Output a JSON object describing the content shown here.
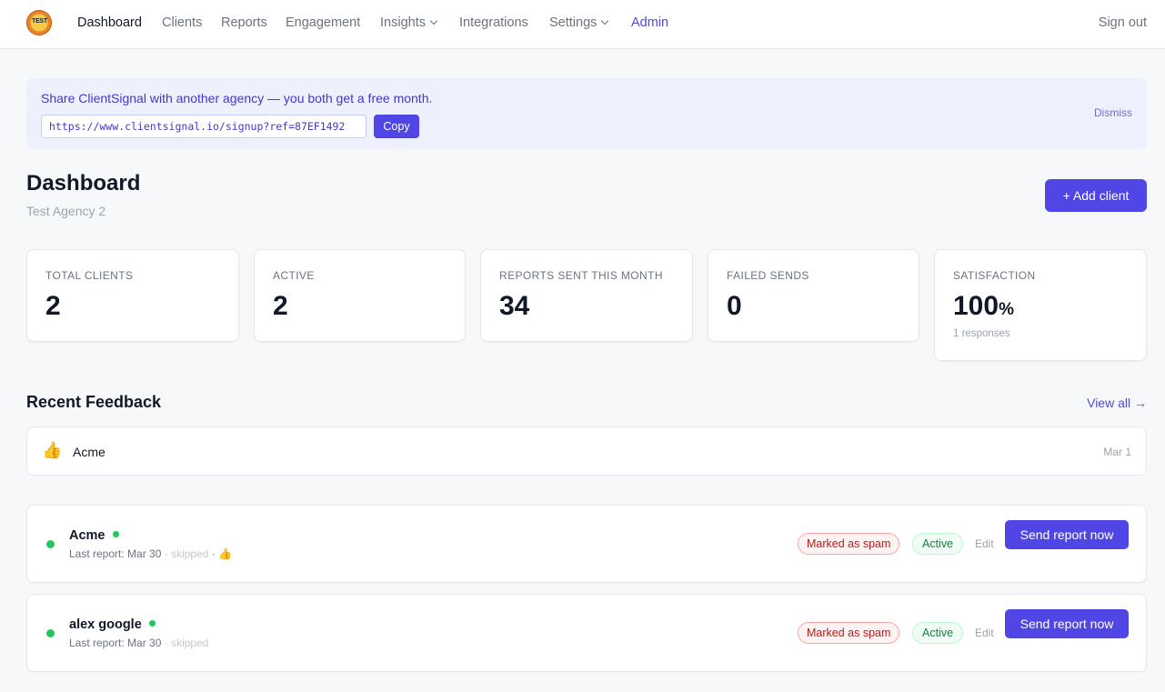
{
  "nav": {
    "logo_text": "TEST",
    "items": [
      "Dashboard",
      "Clients",
      "Reports",
      "Engagement",
      "Insights",
      "Integrations",
      "Settings",
      "Admin"
    ],
    "sign_out": "Sign out"
  },
  "banner": {
    "text": "Share ClientSignal with another agency — you both get a free month.",
    "referral_url": "https://www.clientsignal.io/signup?ref=87EF1492",
    "copy_label": "Copy",
    "dismiss_label": "Dismiss"
  },
  "page": {
    "title": "Dashboard",
    "subtitle": "Test Agency 2",
    "add_client_label": "+ Add client"
  },
  "stats": [
    {
      "label": "TOTAL CLIENTS",
      "value": "2"
    },
    {
      "label": "ACTIVE",
      "value": "2"
    },
    {
      "label": "REPORTS SENT THIS MONTH",
      "value": "34"
    },
    {
      "label": "FAILED SENDS",
      "value": "0"
    },
    {
      "label": "SATISFACTION",
      "value": "100",
      "unit": "%",
      "sub": "1 responses"
    }
  ],
  "feedback": {
    "title": "Recent Feedback",
    "view_all": "View all →",
    "items": [
      {
        "icon": "👍",
        "client": "Acme",
        "date": "Mar 1"
      }
    ]
  },
  "clients": [
    {
      "name": "Acme",
      "last_report": "Last report: Mar 30",
      "skipped": "· skipped",
      "extra": "· 👍",
      "spam_badge": "Marked as spam",
      "status": "Active",
      "edit": "Edit",
      "send_label": "Send report now"
    },
    {
      "name": "alex google",
      "last_report": "Last report: Mar 30",
      "skipped": "· skipped",
      "extra": "",
      "spam_badge": "Marked as spam",
      "status": "Active",
      "edit": "Edit",
      "send_label": "Send report now"
    }
  ],
  "colors": {
    "accent": "#4f46e5",
    "status_green": "#22c55e",
    "spam_red": "#b91c1c",
    "banner_bg": "#eef0fd"
  }
}
